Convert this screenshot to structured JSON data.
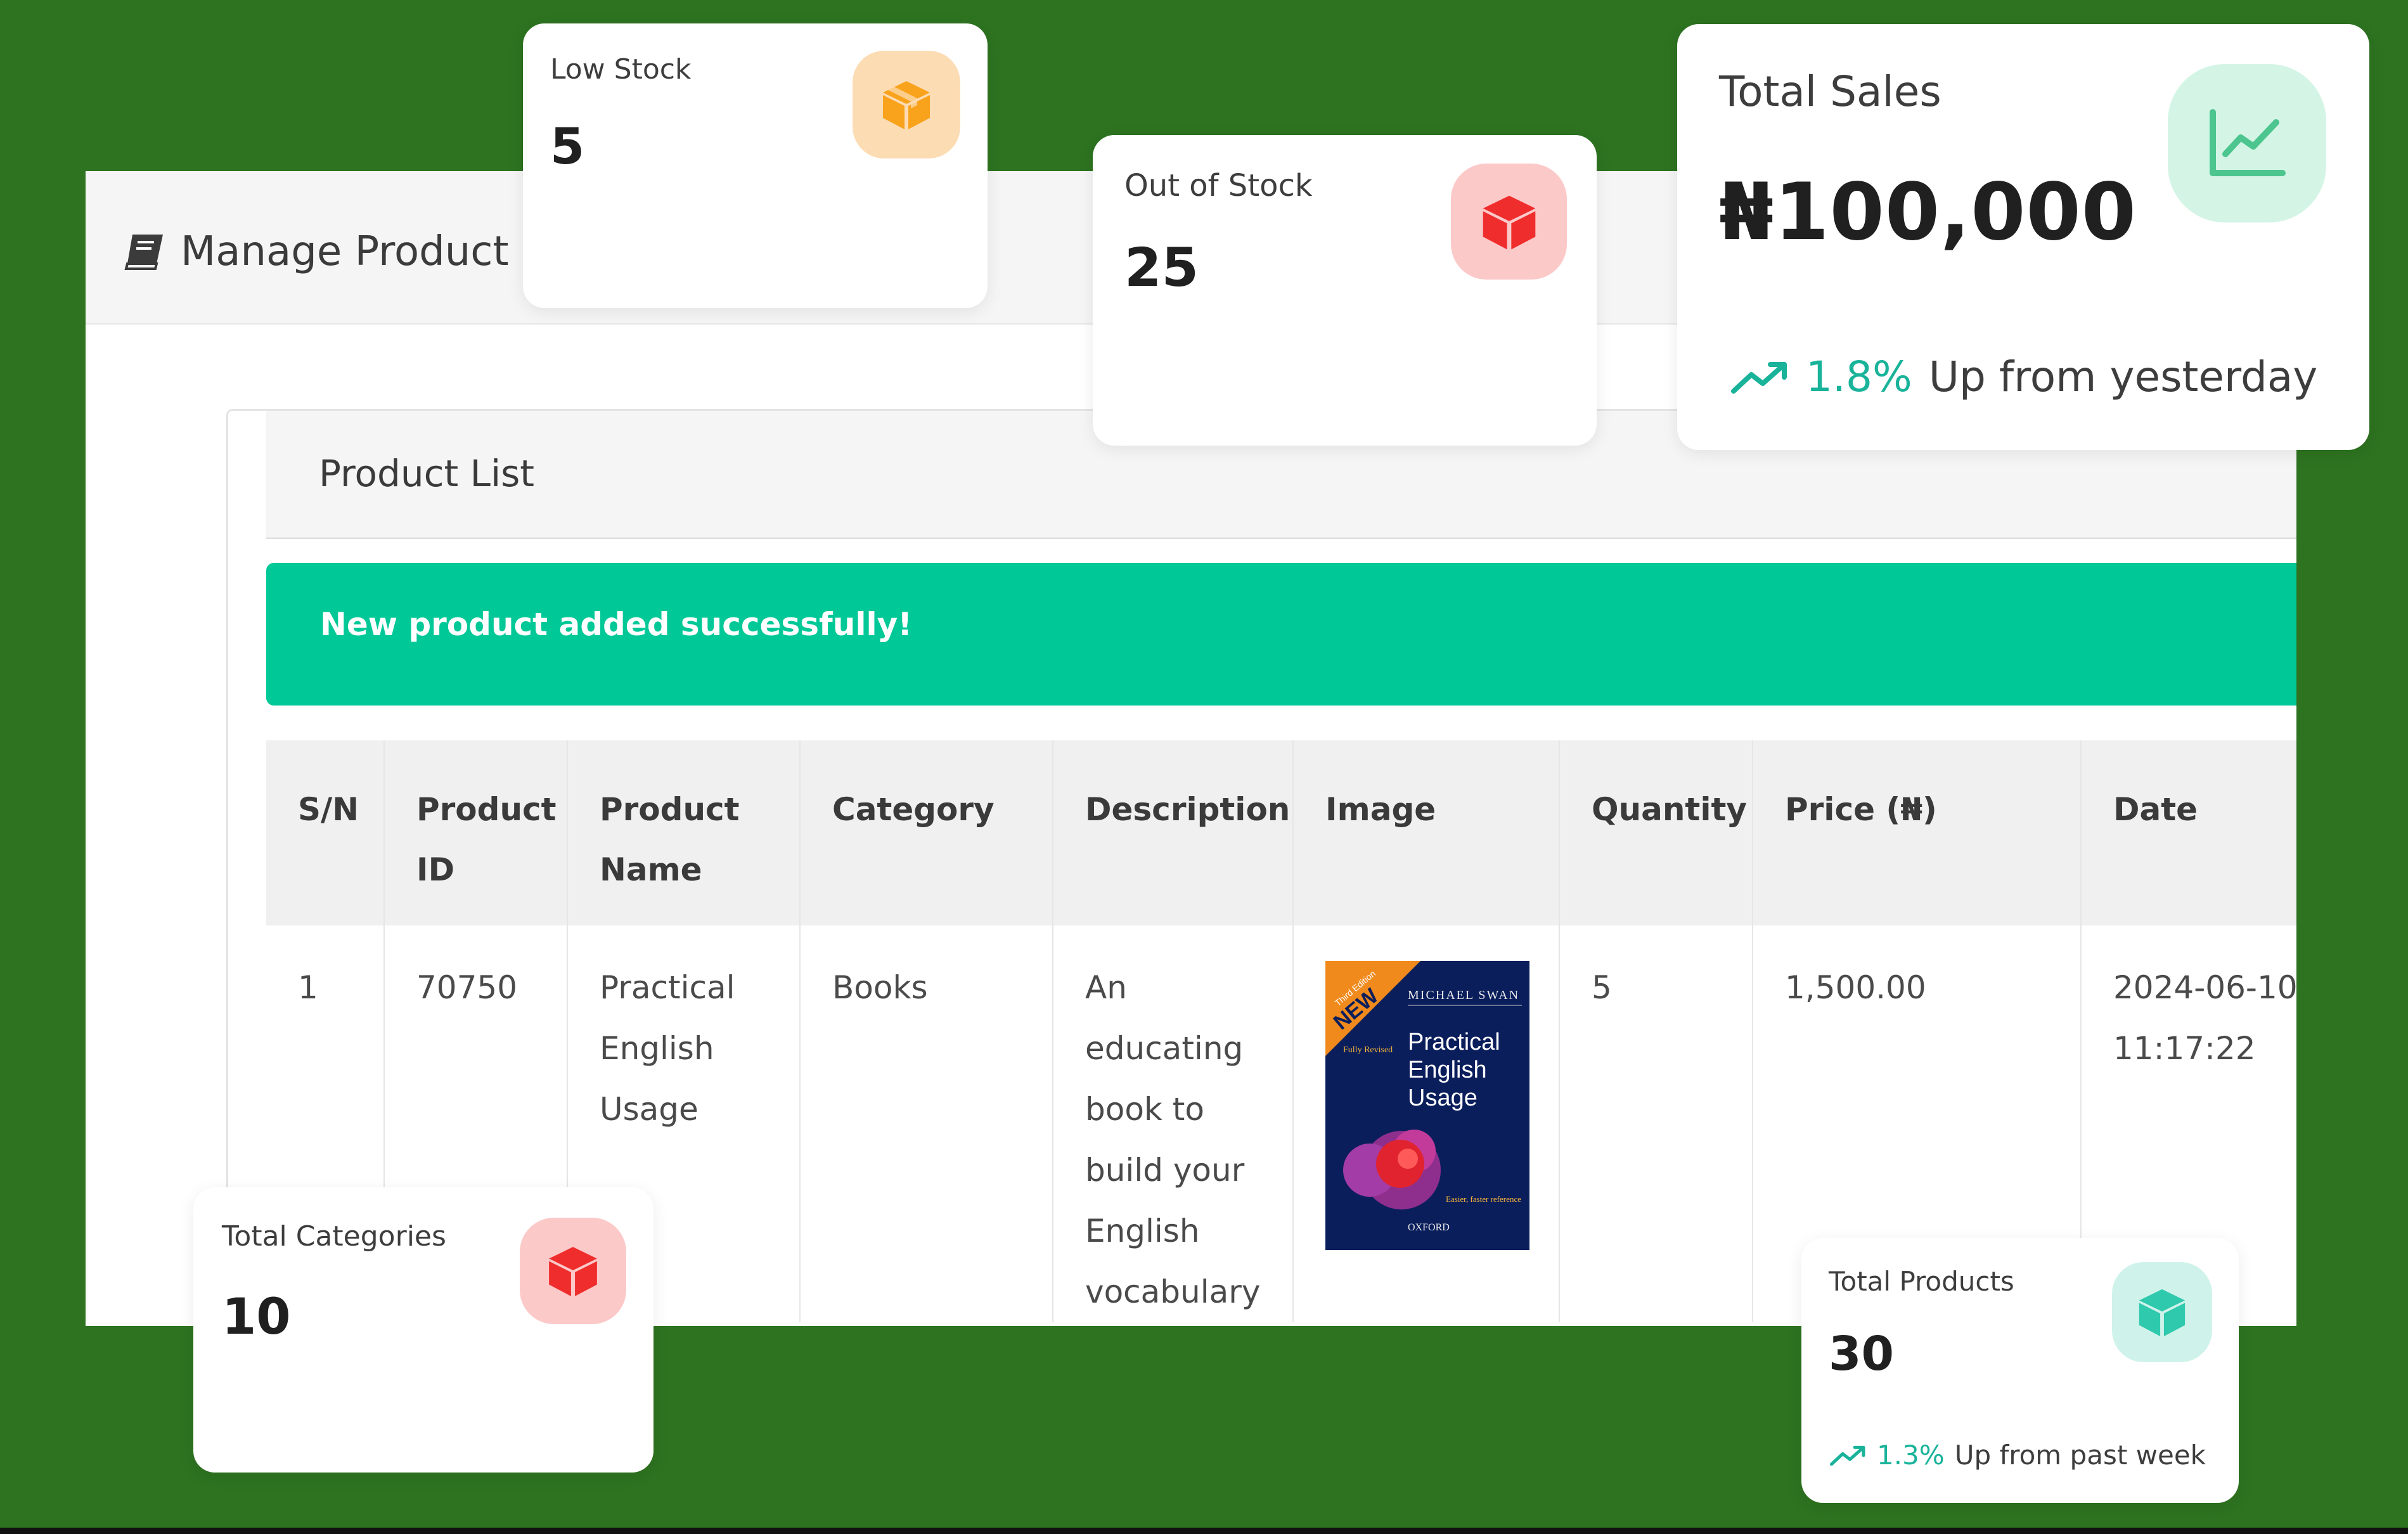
{
  "page": {
    "title": "Manage Product",
    "title_icon": "book-icon"
  },
  "card": {
    "title": "Product List"
  },
  "alert": {
    "message": "New product added successfully!"
  },
  "table": {
    "headers": [
      "S/N",
      "Product ID",
      "Product Name",
      "Category",
      "Description",
      "Image",
      "Quantity",
      "Price (₦)",
      "Date"
    ],
    "rows": [
      {
        "sn": "1",
        "product_id": "70750",
        "product_name": "Practical English Usage",
        "category": "Books",
        "description": "An educating book to build your English vocabulary",
        "image": {
          "edition_banner": "NEW",
          "edition_note": "Third Edition",
          "author": "MICHAEL SWAN",
          "title": "Practical English Usage",
          "subtitle": "Fully Revised",
          "tagline": "Easier, faster reference",
          "publisher": "OXFORD"
        },
        "quantity": "5",
        "price": "1,500.00",
        "date": "2024-06-10 11:17:22"
      }
    ]
  },
  "stats": {
    "low_stock": {
      "label": "Low Stock",
      "value": "5",
      "icon": "box-icon",
      "color": "#f9a21b",
      "bg": "#fcdcb3"
    },
    "out_of_stock": {
      "label": "Out of Stock",
      "value": "25",
      "icon": "box-icon",
      "color": "#f02d2d",
      "bg": "#fcc9c9"
    },
    "total_sales": {
      "label": "Total Sales",
      "value": "₦100,000",
      "icon": "line-chart-icon",
      "color": "#4cc58f",
      "bg": "#d4f5e5",
      "trend_pct": "1.8%",
      "trend_text": "Up from yesterday"
    },
    "total_categories": {
      "label": "Total Categories",
      "value": "10",
      "icon": "box-icon",
      "color": "#f02d2d",
      "bg": "#fcc9c9"
    },
    "total_products": {
      "label": "Total Products",
      "value": "30",
      "icon": "box-icon",
      "color": "#2fc9ad",
      "bg": "#cff3ea",
      "trend_pct": "1.3%",
      "trend_text": "Up from past week"
    }
  },
  "colors": {
    "background": "#2d7320",
    "alert": "#00c897",
    "trend": "#19b39a"
  }
}
